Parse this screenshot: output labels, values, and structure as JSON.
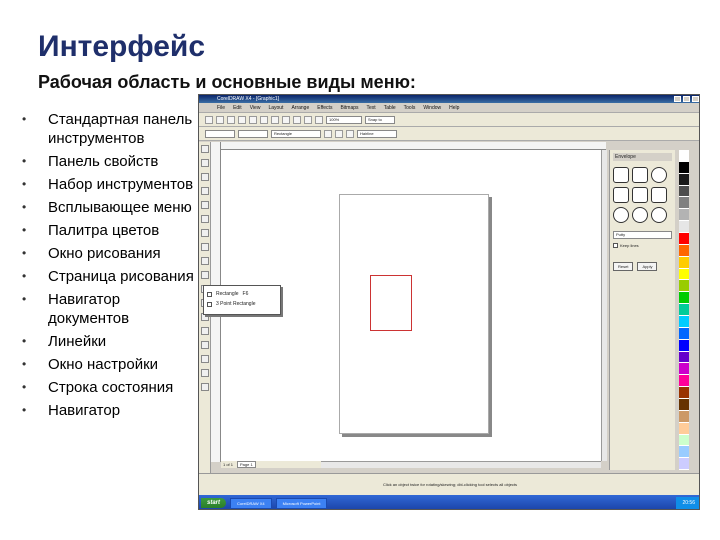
{
  "slide": {
    "title": "Интерфейс",
    "subtitle": "Рабочая область и основные виды меню:",
    "bullets": [
      "Стандартная панель инструментов",
      "Панель свойств",
      "Набор инструментов",
      "Всплывающее меню",
      "Палитра цветов",
      "Окно рисования",
      "Страница рисования",
      "Навигатор документов",
      "Линейки",
      "Окно настройки",
      "Строка состояния",
      "Навигатор"
    ],
    "bullet_glyph": "•"
  },
  "screenshot": {
    "window_title": "CorelDRAW X4 - [Graphic1]",
    "menu": [
      "File",
      "Edit",
      "View",
      "Layout",
      "Arrange",
      "Effects",
      "Bitmaps",
      "Text",
      "Table",
      "Tools",
      "Window",
      "Help"
    ],
    "zoom": "100%",
    "snap": "Snap to",
    "property_shape": "Rectangle",
    "outline": "Hairline",
    "flyout_items": [
      "Rectangle",
      "3 Point Rectangle"
    ],
    "flyout_shortcut": "F6",
    "docker_title": "Envelope",
    "docker_dropdown": "Putty",
    "docker_checkbox": "Keep lines",
    "docker_buttons": [
      "Reset",
      "Apply"
    ],
    "page_nav": "1 of 1",
    "page_tab": "Page 1",
    "status_text": "Click an object twice for rotating/skewing; dbl-clicking tool selects all objects",
    "taskbar_start": "start",
    "taskbar_tasks": [
      "CorelDRAW X4",
      "Microsoft PowerPoint"
    ],
    "clock": "20:56",
    "palette_colors": [
      "#ffffff",
      "#000000",
      "#1a1a1a",
      "#4d4d4d",
      "#808080",
      "#b3b3b3",
      "#e6e6e6",
      "#ff0000",
      "#ff6600",
      "#ffcc00",
      "#ffff00",
      "#99cc00",
      "#00cc00",
      "#00cc99",
      "#00ccff",
      "#0066ff",
      "#0000ff",
      "#6600cc",
      "#cc00cc",
      "#ff0099",
      "#993300",
      "#663300",
      "#cc9966",
      "#ffcc99",
      "#ccffcc",
      "#99ccff",
      "#ccccff"
    ]
  }
}
